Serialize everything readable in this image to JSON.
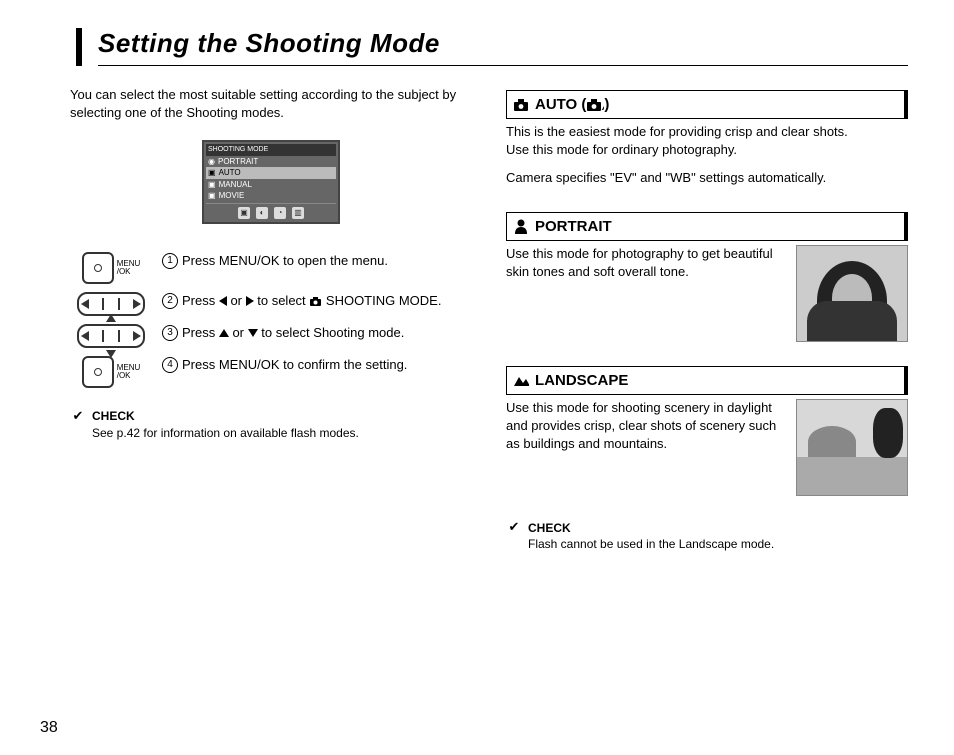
{
  "page_number": "38",
  "title": "Setting the Shooting Mode",
  "intro": "You can select the most suitable setting according to the subject by selecting one of the Shooting modes.",
  "lcd": {
    "header": "SHOOTING MODE",
    "items": [
      "PORTRAIT",
      "AUTO",
      "MANUAL",
      "MOVIE"
    ],
    "selected_index": 1
  },
  "steps": [
    {
      "num": "1",
      "text": "Press MENU/OK to open the menu.",
      "control": "menu-ok"
    },
    {
      "num": "2",
      "text_pre": "Press ",
      "text_mid": " or ",
      "text_post": " to select ",
      "text_end": " SHOOTING MODE.",
      "control": "left-right",
      "icons": "lr-camera"
    },
    {
      "num": "3",
      "text_pre": "Press ",
      "text_mid": " or ",
      "text_post": " to select Shooting mode.",
      "control": "up-down",
      "icons": "ud"
    },
    {
      "num": "4",
      "text": "Press MENU/OK to confirm the setting.",
      "control": "menu-ok"
    }
  ],
  "menu_label_top": "MENU",
  "menu_label_bottom": "/OK",
  "check_left": {
    "title": "CHECK",
    "text": "See p.42 for information on available flash modes."
  },
  "modes": {
    "auto": {
      "title_pre": "AUTO (",
      "title_post": ")",
      "body1": "This is the easiest mode for providing crisp and clear shots.",
      "body2": "Use this mode for ordinary photography.",
      "body3": "Camera specifies \"EV\" and \"WB\" settings automatically."
    },
    "portrait": {
      "title": "PORTRAIT",
      "body": "Use this mode for photography to get beautiful skin tones and soft overall tone."
    },
    "landscape": {
      "title": "LANDSCAPE",
      "body": "Use this mode for shooting scenery in daylight and provides crisp, clear shots of scenery such as buildings and mountains."
    }
  },
  "check_right": {
    "title": "CHECK",
    "text": "Flash cannot be used in the Landscape mode."
  }
}
